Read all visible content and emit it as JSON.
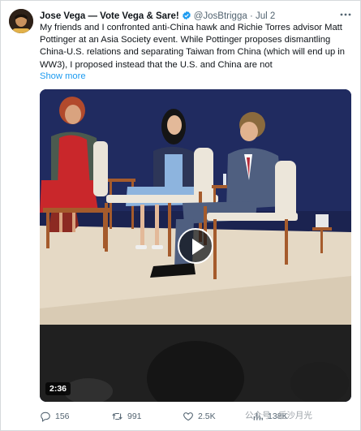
{
  "tweet": {
    "author_name": "Jose Vega — Vote Vega & Sare!",
    "handle": "@JosBtrigga",
    "separator": "·",
    "date": "Jul 2",
    "text": "My friends and I confronted anti-China hawk and Richie Torres advisor Matt Pottinger at an Asia Society event. While Pottinger proposes dismantling China-U.S. relations and separating Taiwan from China (which will end up in WW3), I proposed instead that the U.S. and China are not",
    "show_more": "Show more",
    "verified": true
  },
  "media": {
    "type": "video",
    "duration": "2:36"
  },
  "actions": {
    "replies": "156",
    "reposts": "991",
    "likes": "2.5K",
    "views": "138K"
  },
  "watermark": "公众号 · 后沙月光",
  "icons": [
    "avatar",
    "verified-badge-icon",
    "more-icon",
    "play-icon",
    "reply-icon",
    "repost-icon",
    "like-icon",
    "views-icon"
  ],
  "colors": {
    "accent": "#1d9bf0",
    "muted": "#536471",
    "stage_backdrop": "#1b2350"
  }
}
